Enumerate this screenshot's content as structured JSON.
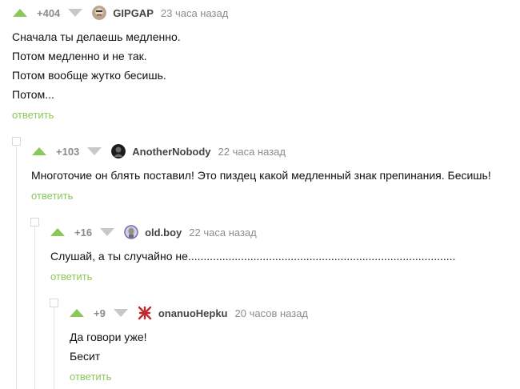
{
  "comments": [
    {
      "rating": "+404",
      "user": "GIPGAP",
      "time": "23 часа назад",
      "lines": [
        "Сначала ты делаешь медленно.",
        "Потом медленно и не так.",
        "Потом вообще жутко бесишь.",
        "Потом..."
      ],
      "reply": "ответить",
      "avatar_icon": "face-avatar-icon"
    },
    {
      "rating": "+103",
      "user": "AnotherNobody",
      "time": "22 часа назад",
      "lines": [
        "Многоточие он блять поставил! Это пиздец какой медленный знак препинания. Бесишь!"
      ],
      "reply": "ответить",
      "avatar_icon": "dark-avatar-icon"
    },
    {
      "rating": "+16",
      "user": "old.boy",
      "time": "22 часа назад",
      "lines": [
        "Слушай, а ты случайно не......................................................................................"
      ],
      "reply": "ответить",
      "avatar_icon": "portrait-avatar-icon"
    },
    {
      "rating": "+9",
      "user": "onanuoHepku",
      "time": "20 часов назад",
      "lines": [
        "Да говори уже!",
        "Бесит"
      ],
      "reply": "ответить",
      "avatar_icon": "red-glyph-avatar-icon"
    }
  ],
  "colors": {
    "accent": "#8ac858",
    "muted": "#8c8c8c",
    "downvote": "#c8c8c8"
  }
}
